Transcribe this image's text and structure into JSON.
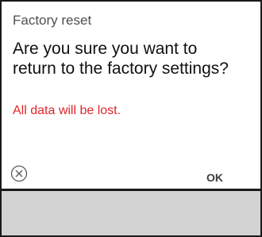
{
  "dialog": {
    "title": "Factory reset",
    "message": "Are you sure you want to return to the factory settings?",
    "warning": "All data will be lost.",
    "cancel_icon": "close-circle-icon",
    "ok_label": "OK"
  },
  "colors": {
    "warning_text": "#e0262b",
    "bottom_panel": "#d2d2d2",
    "border": "#1a1a1a"
  }
}
